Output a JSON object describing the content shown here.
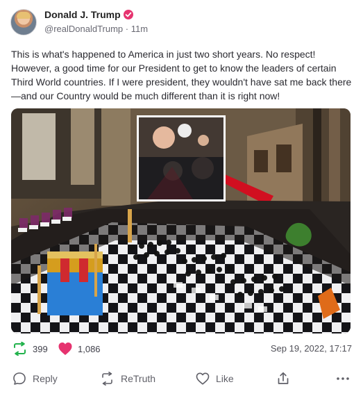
{
  "post": {
    "author_name": "Donald J. Trump",
    "handle_time": "@realDonaldTrump · 11m",
    "text": "This is what's happened to America in just two short years. No respect! However, a good time for our President to get to know the leaders of certain Third World countries. If I were president, they wouldn't have sat me back there—and our Country would be much different than it is right now!"
  },
  "stats": {
    "retruths": "399",
    "likes": "1,086",
    "timestamp": "Sep 19, 2022, 17:17"
  },
  "actions": {
    "reply": "Reply",
    "retruth": "ReTruth",
    "like": "Like"
  },
  "colors": {
    "verified": "#e6336f",
    "retruth_green": "#22b24c",
    "like_pink": "#e6336f"
  },
  "icons": [
    "avatar",
    "verified-icon",
    "retruth-icon",
    "heart-icon",
    "reply-icon",
    "like-icon",
    "share-icon",
    "more-icon"
  ]
}
